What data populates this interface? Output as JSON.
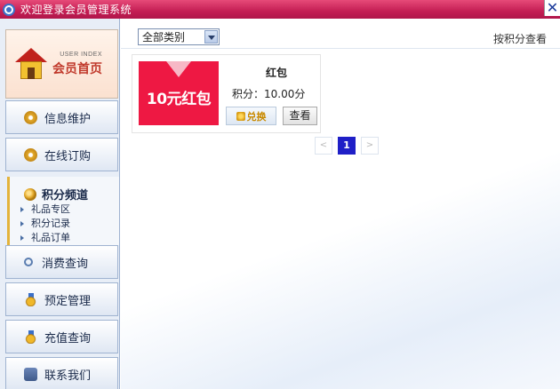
{
  "window": {
    "title": "欢迎登录会员管理系统",
    "close": "✕"
  },
  "sidebar": {
    "home": {
      "en": "USER INDEX",
      "label": "会员首页"
    },
    "items": [
      {
        "label": "信息维护",
        "icon": "gear-icon"
      },
      {
        "label": "在线订购",
        "icon": "gear-icon"
      },
      {
        "label": "积分频道",
        "icon": "coins-icon",
        "subitems": [
          "礼品专区",
          "积分记录",
          "礼品订单"
        ]
      },
      {
        "label": "消费查询",
        "icon": "search-icon"
      },
      {
        "label": "预定管理",
        "icon": "medal-icon"
      },
      {
        "label": "充值查询",
        "icon": "medal-icon"
      },
      {
        "label": "联系我们",
        "icon": "phone-icon"
      }
    ]
  },
  "toolbar": {
    "category_selected": "全部类别",
    "sort_label": "按积分查看"
  },
  "gift": {
    "image_text": "10元红包",
    "name": "红包",
    "points": "积分：10.00分",
    "redeem_label": "兑换",
    "view_label": "查看"
  },
  "pager": {
    "prev": "<",
    "current": "1",
    "next": ">"
  },
  "colors": {
    "title_bar": "#c41e54",
    "gift_bg": "#ee1843",
    "pager_active": "#1f1fc7"
  }
}
